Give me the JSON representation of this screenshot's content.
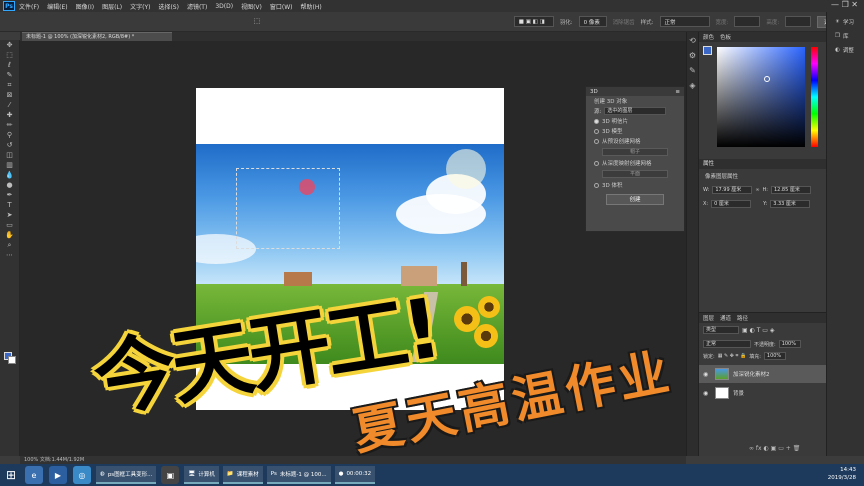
{
  "menubar": {
    "logo": "Ps",
    "items": [
      "文件(F)",
      "编辑(E)",
      "图像(I)",
      "图层(L)",
      "文字(Y)",
      "选择(S)",
      "滤镜(T)",
      "3D(D)",
      "视图(V)",
      "窗口(W)",
      "帮助(H)"
    ],
    "win_controls": "—  ❐  ✕"
  },
  "options": {
    "feather_label": "羽化:",
    "feather_value": "0 像素",
    "antialias_label": "消除锯齿",
    "style_label": "样式:",
    "style_value": "正常",
    "width_label": "宽度:",
    "height_label": "高度:",
    "select_mask_button": "选择并遮住..."
  },
  "document": {
    "tab_title": "未标题-1 @ 100% (加深锐化素材2, RGB/8#) *",
    "status": "100%      文档:1.44M/1.92M"
  },
  "panel3d": {
    "title": "3D",
    "subtitle": "创建 3D 对象",
    "source_label": "源:",
    "source_value": "选中的图层",
    "options": [
      "3D 明信片",
      "3D 模型",
      "从预设创建网格",
      "从深度映射创建网格",
      "3D 体积"
    ],
    "preset_button": "帽子",
    "depth_button": "平面",
    "create_button": "创建"
  },
  "color_panel": {
    "tabs": [
      "颜色",
      "色板"
    ],
    "accent": "#3b67c7"
  },
  "properties": {
    "title": "属性",
    "subtitle": "像素图层属性",
    "w_label": "W:",
    "w_value": "17.99 厘米",
    "h_label": "H:",
    "h_value": "12.85 厘米",
    "x_label": "X:",
    "x_value": "0 厘米",
    "y_label": "Y:",
    "y_value": "3.33 厘米"
  },
  "layers": {
    "tabs": [
      "图层",
      "通道",
      "路径"
    ],
    "filter": "类型",
    "blend_mode": "正常",
    "opacity_label": "不透明度:",
    "opacity_value": "100%",
    "lock_label": "锁定:",
    "fill_label": "填充:",
    "fill_value": "100%",
    "items": [
      {
        "name": "加深锐化素材2"
      },
      {
        "name": "背景"
      }
    ]
  },
  "learn": {
    "items": [
      "学习",
      "库",
      "调整"
    ]
  },
  "overlay": {
    "headline": "今天开工!",
    "subheadline": "夏天高温作业"
  },
  "taskbar": {
    "tasks": [
      "ps图框工具变形...",
      "计算机",
      "课程素材",
      "未标题-1 @ 100...",
      "00:00:32"
    ],
    "time": "14:43",
    "date": "2019/3/28"
  }
}
